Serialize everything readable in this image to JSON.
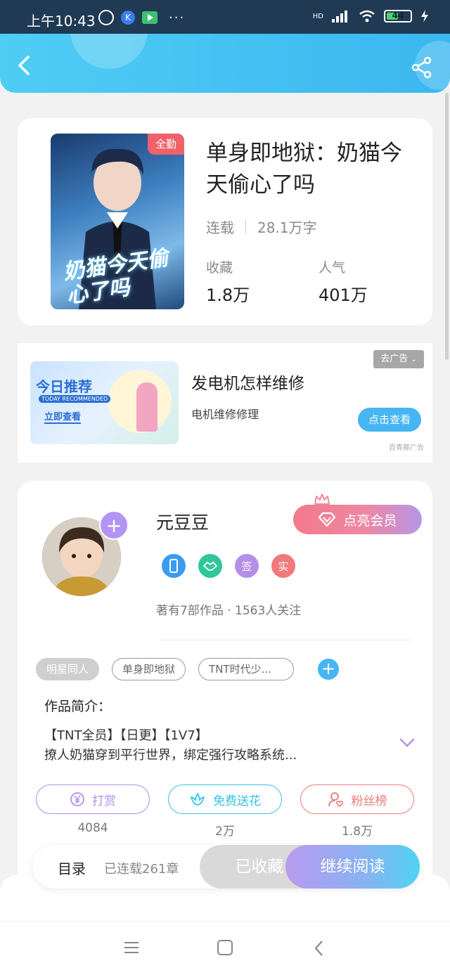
{
  "status_bar": {
    "time": "上午10:43",
    "dots": "···",
    "network": "HD",
    "battery": "44",
    "k_icon": "K"
  },
  "header": {
    "back_icon": "chevron-left-icon",
    "share_icon": "share-icon"
  },
  "book": {
    "badge": "全勤",
    "title": "单身即地狱：奶猫今天偷心了吗",
    "cover_text": "奶猫今天偷心了吗",
    "status": "连载",
    "word_count": "28.1万字",
    "favorites_label": "收藏",
    "favorites_value": "1.8万",
    "popularity_label": "人气",
    "popularity_value": "401万"
  },
  "ad": {
    "close_label": "去广告",
    "banner_title": "今日推荐",
    "banner_subtitle": "TODAY RECOMMENDED",
    "banner_cta": "立即查看",
    "title": "发电机怎样维修",
    "description": "电机维修修理",
    "button": "点击查看",
    "source": "百青藤广告"
  },
  "author": {
    "name": "元豆豆",
    "plus": "+",
    "vip_button": "点亮会员",
    "badges": [
      {
        "label": "",
        "color": "#3b9bf0"
      },
      {
        "label": "",
        "color": "#2fc79a"
      },
      {
        "label": "签",
        "color": "#b48ee8"
      },
      {
        "label": "实",
        "color": "#f07a7a"
      }
    ],
    "stats": "著有7部作品 · 1563人关注"
  },
  "tags": [
    "明星同人",
    "单身即地狱",
    "TNT时代少..."
  ],
  "tag_add": "+",
  "intro": {
    "title": "作品简介：",
    "line1": "【TNT全员】【日更】【1V7】",
    "line2": "撩人奶猫穿到平行世界，绑定强行攻略系统..."
  },
  "actions": [
    {
      "label": "打赏",
      "count": "4084",
      "color": "#b38ee8",
      "icon": "yen-icon"
    },
    {
      "label": "免费送花",
      "count": "2万",
      "color": "#35c3e3",
      "icon": "flower-icon"
    },
    {
      "label": "粉丝榜",
      "count": "1.8万",
      "color": "#ef7a7a",
      "icon": "fan-rank-icon"
    }
  ],
  "bottom_bar": {
    "toc_label": "目录",
    "toc_count": "已连载261章",
    "collected": "已收藏",
    "continue": "继续阅读"
  }
}
